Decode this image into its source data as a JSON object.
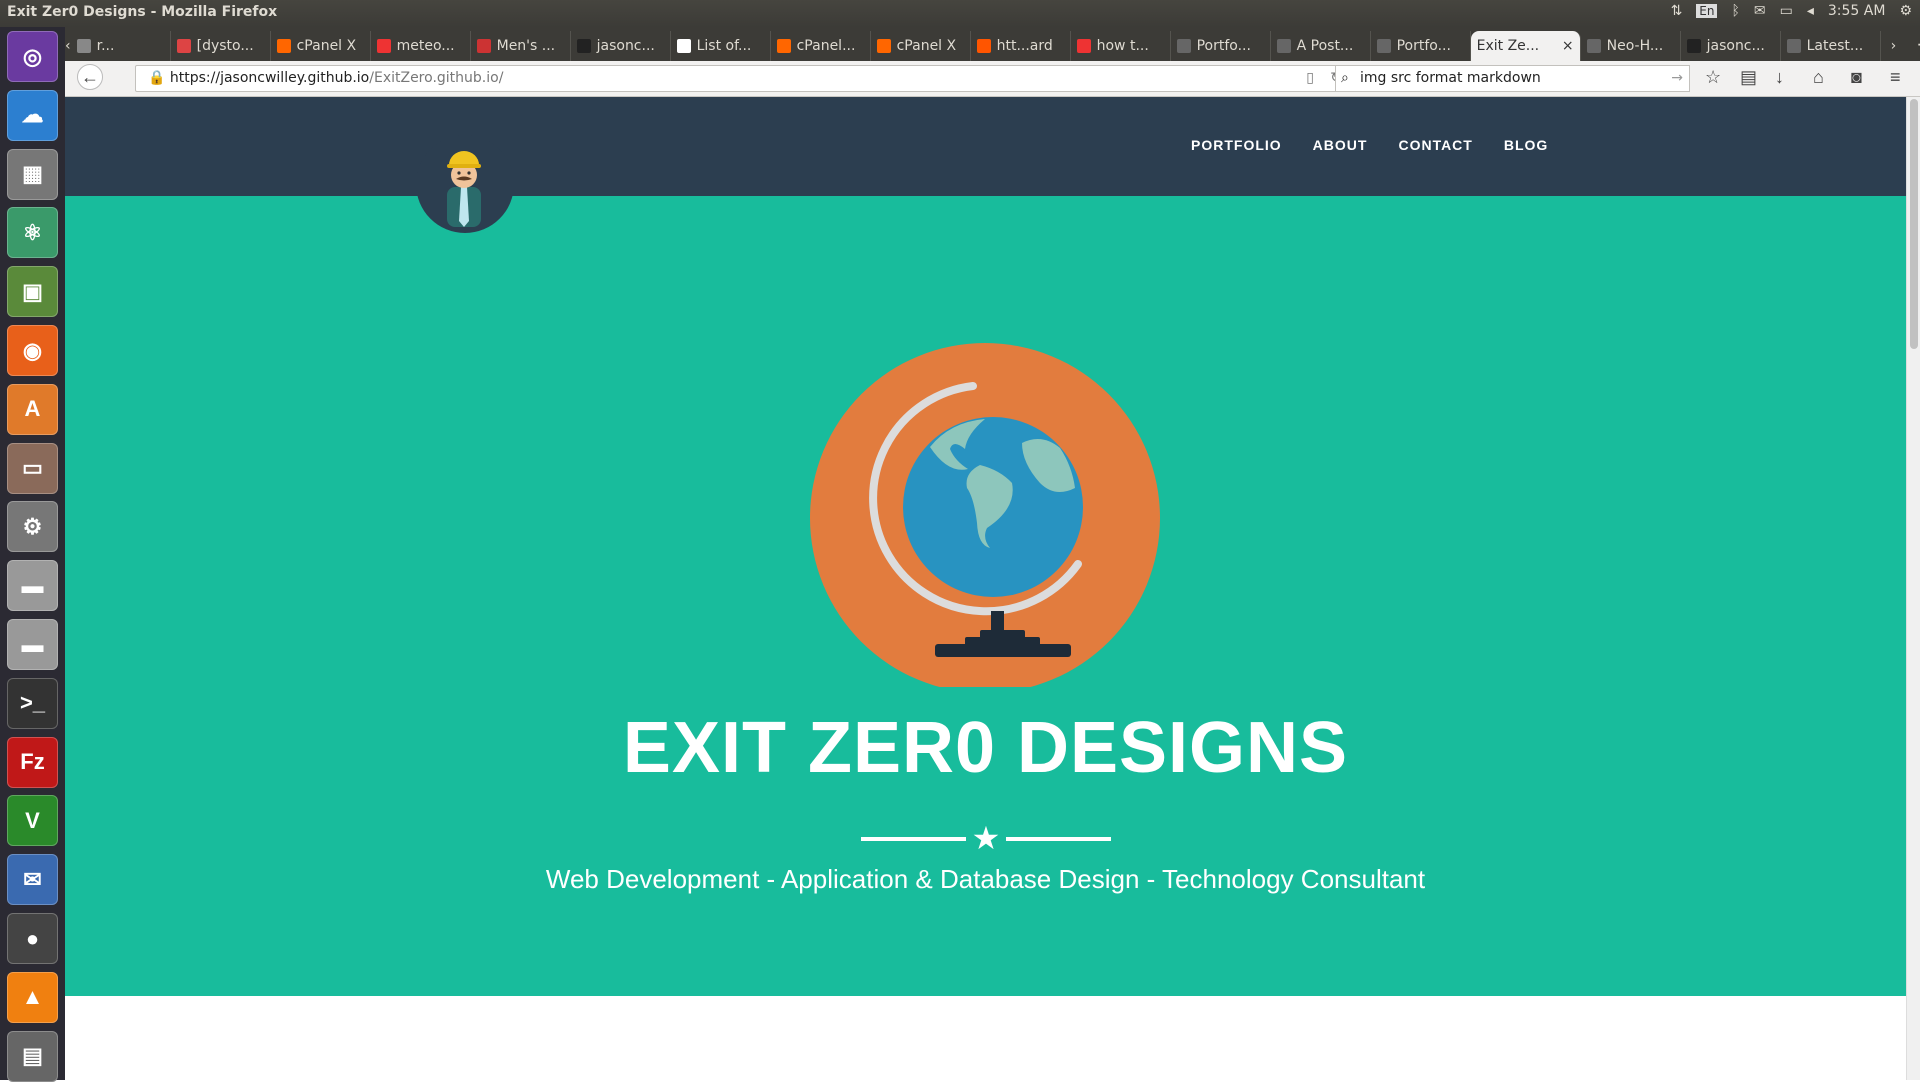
{
  "window": {
    "title": "Exit Zer0 Designs - Mozilla Firefox",
    "clock": "3:55 AM",
    "keyboard": "En"
  },
  "launcher": [
    "ubuntu-dash",
    "cloud",
    "calculator",
    "atom",
    "unity-tweak",
    "firefox",
    "software-center",
    "archive",
    "system-settings",
    "disk",
    "disk",
    "terminal",
    "filezilla",
    "vim",
    "thunderbird",
    "colors",
    "vlc",
    "more"
  ],
  "tabs": [
    {
      "label": "r...",
      "color": "#888"
    },
    {
      "label": "[dysto...",
      "color": "#d44"
    },
    {
      "label": "cPanel X",
      "color": "#f60"
    },
    {
      "label": "meteo...",
      "color": "#e33"
    },
    {
      "label": "Men's ...",
      "color": "#c33"
    },
    {
      "label": "jasonc...",
      "color": "#222"
    },
    {
      "label": "List of...",
      "color": "#fff"
    },
    {
      "label": "cPanel...",
      "color": "#f60"
    },
    {
      "label": "cPanel X",
      "color": "#f60"
    },
    {
      "label": "htt...ard",
      "color": "#f50"
    },
    {
      "label": "how t...",
      "color": "#e33"
    },
    {
      "label": "Portfo...",
      "color": "#666"
    },
    {
      "label": "A Post...",
      "color": "#666"
    },
    {
      "label": "Portfo...",
      "color": "#666"
    },
    {
      "label": "Exit Ze...",
      "color": "",
      "active": true
    },
    {
      "label": "Neo-H...",
      "color": "#666"
    },
    {
      "label": "jasonc...",
      "color": "#222"
    },
    {
      "label": "Latest...",
      "color": "#666"
    }
  ],
  "url": {
    "domain": "https://jasoncwilley.github.io",
    "path": "/ExitZero.github.io/"
  },
  "search": {
    "value": "img src format markdown"
  },
  "site": {
    "nav": [
      "PORTFOLIO",
      "ABOUT",
      "CONTACT",
      "BLOG"
    ],
    "title": "EXIT ZER0 DESIGNS",
    "subtitle": "Web Development - Application & Database Design - Technology Consultant",
    "colors": {
      "header": "#2c3e50",
      "hero": "#18bc9c",
      "globe_bg": "#e27c3e"
    }
  }
}
